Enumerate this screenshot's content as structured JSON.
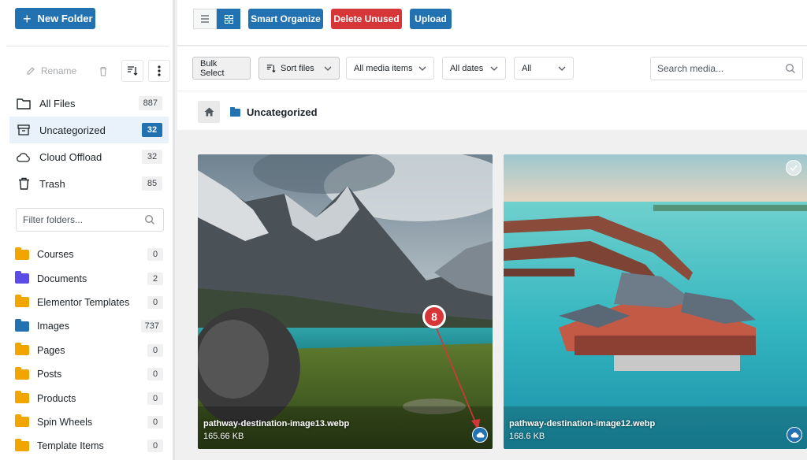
{
  "sidebar": {
    "new_folder_label": "New Folder",
    "toolbar": {
      "rename_label": "Rename"
    },
    "nav": [
      {
        "label": "All Files",
        "count": "887",
        "icon": "folder-open-icon"
      },
      {
        "label": "Uncategorized",
        "count": "32",
        "icon": "archive-icon",
        "active": true
      },
      {
        "label": "Cloud Offload",
        "count": "32",
        "icon": "cloud-icon"
      },
      {
        "label": "Trash",
        "count": "85",
        "icon": "trash-icon"
      }
    ],
    "filter_placeholder": "Filter folders...",
    "folders": [
      {
        "label": "Courses",
        "count": "0",
        "color": "#f0a500"
      },
      {
        "label": "Documents",
        "count": "2",
        "color": "#5b4ce8"
      },
      {
        "label": "Elementor Templates",
        "count": "0",
        "color": "#f0a500"
      },
      {
        "label": "Images",
        "count": "737",
        "color": "#2271b1"
      },
      {
        "label": "Pages",
        "count": "0",
        "color": "#f0a500"
      },
      {
        "label": "Posts",
        "count": "0",
        "color": "#f0a500"
      },
      {
        "label": "Products",
        "count": "0",
        "color": "#f0a500"
      },
      {
        "label": "Spin Wheels",
        "count": "0",
        "color": "#f0a500"
      },
      {
        "label": "Template Items",
        "count": "0",
        "color": "#f0a500"
      }
    ]
  },
  "topbar": {
    "smart_organize": "Smart Organize",
    "delete_unused": "Delete Unused",
    "upload": "Upload"
  },
  "filterbar": {
    "bulk_select": "Bulk Select",
    "sort_files": "Sort files",
    "media_items": "All media items",
    "dates": "All dates",
    "all": "All",
    "search_placeholder": "Search media..."
  },
  "breadcrumb": {
    "current": "Uncategorized"
  },
  "media": [
    {
      "filename": "pathway-destination-image13.webp",
      "size": "165.66 KB"
    },
    {
      "filename": "pathway-destination-image12.webp",
      "size": "168.6 KB"
    }
  ],
  "annotation": {
    "step": "8"
  },
  "colors": {
    "accent": "#2271b1",
    "danger": "#d63638",
    "folder_default": "#f0a500"
  }
}
